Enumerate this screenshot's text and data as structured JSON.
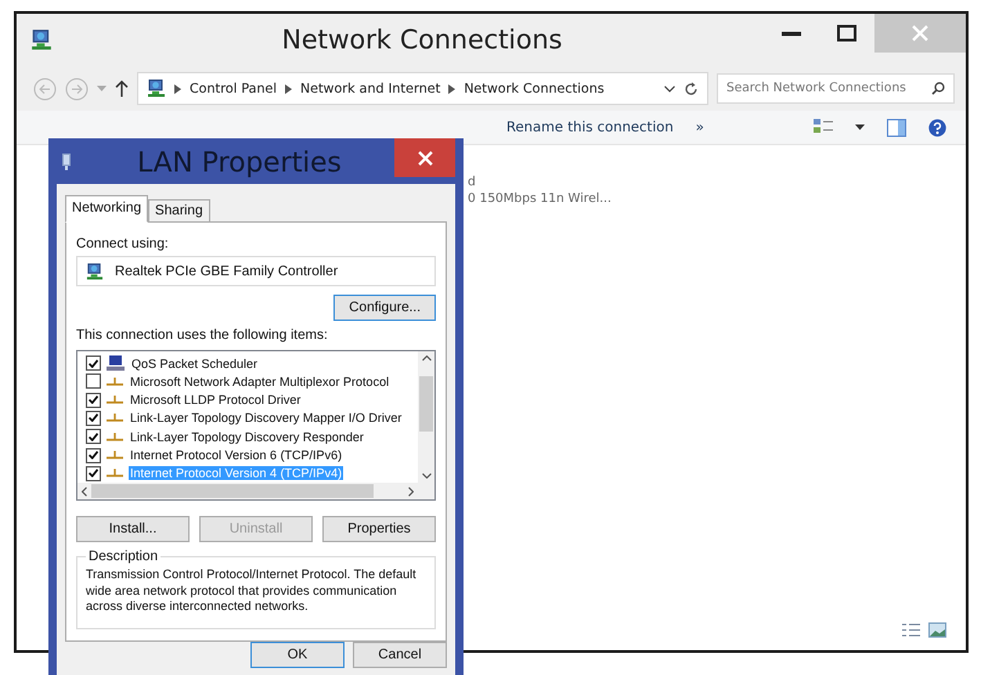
{
  "window": {
    "title": "Network Connections"
  },
  "address_bar": {
    "breadcrumbs": [
      "Control Panel",
      "Network and Internet",
      "Network Connections"
    ]
  },
  "search": {
    "placeholder": "Search Network Connections"
  },
  "command_bar": {
    "items": [
      "Rename this connection"
    ],
    "overflow": "»"
  },
  "content": {
    "partial_lines": [
      "d",
      "0 150Mbps 11n Wirel..."
    ]
  },
  "dialog": {
    "title": "LAN Properties",
    "tabs": [
      {
        "label": "Networking",
        "selected": true
      },
      {
        "label": "Sharing",
        "selected": false
      }
    ],
    "connect_using_label": "Connect using:",
    "adapter": "Realtek PCIe GBE Family Controller",
    "configure_button": "Configure...",
    "items_label": "This connection uses the following items:",
    "items": [
      {
        "label": "QoS Packet Scheduler",
        "checked": true,
        "selected": false,
        "kind": "service"
      },
      {
        "label": "Microsoft Network Adapter Multiplexor Protocol",
        "checked": false,
        "selected": false,
        "kind": "protocol"
      },
      {
        "label": "Microsoft LLDP Protocol Driver",
        "checked": true,
        "selected": false,
        "kind": "protocol"
      },
      {
        "label": "Link-Layer Topology Discovery Mapper I/O Driver",
        "checked": true,
        "selected": false,
        "kind": "protocol"
      },
      {
        "label": "Link-Layer Topology Discovery Responder",
        "checked": true,
        "selected": false,
        "kind": "protocol"
      },
      {
        "label": "Internet Protocol Version 6 (TCP/IPv6)",
        "checked": true,
        "selected": false,
        "kind": "protocol"
      },
      {
        "label": "Internet Protocol Version 4 (TCP/IPv4)",
        "checked": true,
        "selected": true,
        "kind": "protocol"
      }
    ],
    "item_buttons": [
      {
        "label": "Install...",
        "disabled": false
      },
      {
        "label": "Uninstall",
        "disabled": true
      },
      {
        "label": "Properties",
        "disabled": false
      }
    ],
    "description": {
      "title": "Description",
      "text": "Transmission Control Protocol/Internet Protocol. The default wide area network protocol that provides communication across diverse interconnected networks."
    },
    "footer_buttons": [
      "OK",
      "Cancel"
    ]
  }
}
